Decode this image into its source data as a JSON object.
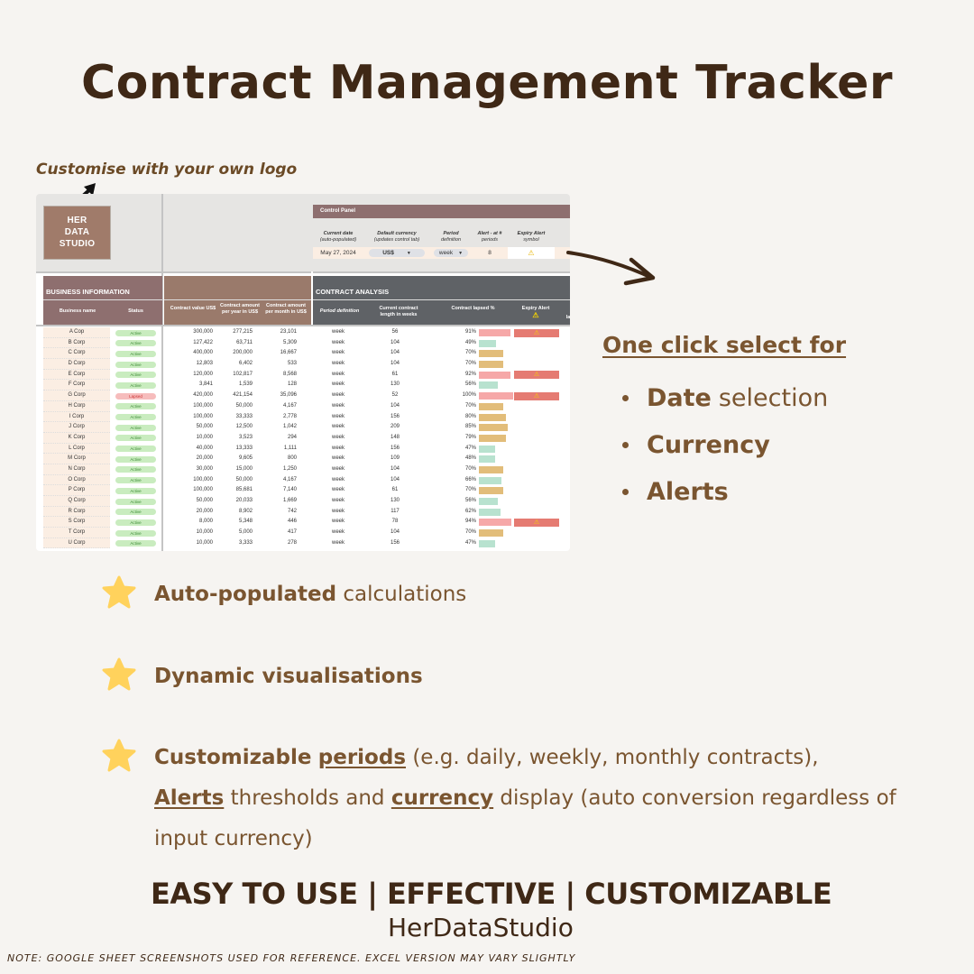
{
  "title": "Contract Management Tracker",
  "logo_note": "Customise with your own logo",
  "sheet": {
    "logo_text": [
      "HER",
      "DATA",
      "STUDIO"
    ],
    "control_panel": {
      "header": "Control Panel",
      "labels": [
        {
          "main": "Current date",
          "sub": "(auto-populated)"
        },
        {
          "main": "Default currency",
          "sub": "(updates control tab)"
        },
        {
          "main": "Period",
          "sub": "definition"
        },
        {
          "main": "Alert - at #",
          "sub": "periods"
        },
        {
          "main": "Expiry Alert",
          "sub": "symbol"
        }
      ],
      "current_date": "May 27, 2024",
      "currency": "US$",
      "period": "week",
      "alert_periods": "8",
      "alert_symbol": "⚠"
    },
    "sections": {
      "business": "BUSINESS INFORMATION",
      "analysis": "CONTRACT ANALYSIS"
    },
    "columns": {
      "business_name": "Business name",
      "status": "Status",
      "contract_value": "Contract value US$",
      "per_year": "Contract amount per year in US$",
      "per_month": "Contract amount per month in US$",
      "period_def": "Period definition",
      "length": "Current contract length in weeks",
      "lapsed": "Contract lapsed %",
      "expiry_alert": "Expiry Alert",
      "cut_off": "la"
    },
    "rows": [
      {
        "name": "A Cop",
        "status": "Active",
        "value": "300,000",
        "year": "277,215",
        "month": "23,101",
        "period": "week",
        "length": "56",
        "lapsed_pct": 91,
        "alert": true
      },
      {
        "name": "B Corp",
        "status": "Active",
        "value": "127,422",
        "year": "63,711",
        "month": "5,309",
        "period": "week",
        "length": "104",
        "lapsed_pct": 49,
        "alert": false
      },
      {
        "name": "C Corp",
        "status": "Active",
        "value": "400,000",
        "year": "200,000",
        "month": "16,667",
        "period": "week",
        "length": "104",
        "lapsed_pct": 70,
        "alert": false
      },
      {
        "name": "D Corp",
        "status": "Active",
        "value": "12,803",
        "year": "6,402",
        "month": "533",
        "period": "week",
        "length": "104",
        "lapsed_pct": 70,
        "alert": false
      },
      {
        "name": "E Corp",
        "status": "Active",
        "value": "120,000",
        "year": "102,817",
        "month": "8,568",
        "period": "week",
        "length": "61",
        "lapsed_pct": 92,
        "alert": true
      },
      {
        "name": "F Corp",
        "status": "Active",
        "value": "3,841",
        "year": "1,539",
        "month": "128",
        "period": "week",
        "length": "130",
        "lapsed_pct": 56,
        "alert": false
      },
      {
        "name": "G Corp",
        "status": "Lapsed",
        "value": "420,000",
        "year": "421,154",
        "month": "35,096",
        "period": "week",
        "length": "52",
        "lapsed_pct": 100,
        "alert": true
      },
      {
        "name": "H Corp",
        "status": "Active",
        "value": "100,000",
        "year": "50,000",
        "month": "4,167",
        "period": "week",
        "length": "104",
        "lapsed_pct": 70,
        "alert": false
      },
      {
        "name": "I Corp",
        "status": "Active",
        "value": "100,000",
        "year": "33,333",
        "month": "2,778",
        "period": "week",
        "length": "156",
        "lapsed_pct": 80,
        "alert": false
      },
      {
        "name": "J Corp",
        "status": "Active",
        "value": "50,000",
        "year": "12,500",
        "month": "1,042",
        "period": "week",
        "length": "209",
        "lapsed_pct": 85,
        "alert": false
      },
      {
        "name": "K Corp",
        "status": "Active",
        "value": "10,000",
        "year": "3,523",
        "month": "294",
        "period": "week",
        "length": "148",
        "lapsed_pct": 79,
        "alert": false
      },
      {
        "name": "L Corp",
        "status": "Active",
        "value": "40,000",
        "year": "13,333",
        "month": "1,111",
        "period": "week",
        "length": "156",
        "lapsed_pct": 47,
        "alert": false
      },
      {
        "name": "M Corp",
        "status": "Active",
        "value": "20,000",
        "year": "9,605",
        "month": "800",
        "period": "week",
        "length": "109",
        "lapsed_pct": 48,
        "alert": false
      },
      {
        "name": "N Corp",
        "status": "Active",
        "value": "30,000",
        "year": "15,000",
        "month": "1,250",
        "period": "week",
        "length": "104",
        "lapsed_pct": 70,
        "alert": false
      },
      {
        "name": "O Corp",
        "status": "Active",
        "value": "100,000",
        "year": "50,000",
        "month": "4,167",
        "period": "week",
        "length": "104",
        "lapsed_pct": 66,
        "alert": false
      },
      {
        "name": "P Corp",
        "status": "Active",
        "value": "100,000",
        "year": "85,681",
        "month": "7,140",
        "period": "week",
        "length": "61",
        "lapsed_pct": 70,
        "alert": false
      },
      {
        "name": "Q Corp",
        "status": "Active",
        "value": "50,000",
        "year": "20,033",
        "month": "1,669",
        "period": "week",
        "length": "130",
        "lapsed_pct": 56,
        "alert": false
      },
      {
        "name": "R Corp",
        "status": "Active",
        "value": "20,000",
        "year": "8,902",
        "month": "742",
        "period": "week",
        "length": "117",
        "lapsed_pct": 62,
        "alert": false
      },
      {
        "name": "S Corp",
        "status": "Active",
        "value": "8,000",
        "year": "5,348",
        "month": "446",
        "period": "week",
        "length": "78",
        "lapsed_pct": 94,
        "alert": true
      },
      {
        "name": "T Corp",
        "status": "Active",
        "value": "10,000",
        "year": "5,000",
        "month": "417",
        "period": "week",
        "length": "104",
        "lapsed_pct": 70,
        "alert": false
      },
      {
        "name": "U Corp",
        "status": "Active",
        "value": "10,000",
        "year": "3,333",
        "month": "278",
        "period": "week",
        "length": "156",
        "lapsed_pct": 47,
        "alert": false
      }
    ],
    "bar_colors": {
      "low": "#b8e2cf",
      "mid": "#e2bd7a",
      "high": "#f6a8a8",
      "alert": "#e57b72"
    }
  },
  "oneclick": {
    "heading": "One click select for",
    "items": [
      {
        "bold": "Date",
        "rest": "selection"
      },
      {
        "bold": "Currency",
        "rest": ""
      },
      {
        "bold": "Alerts",
        "rest": ""
      }
    ]
  },
  "features": [
    {
      "bold": "Auto-populated",
      "rest": " calculations"
    },
    {
      "bold": "Dynamic visualisations",
      "rest": ""
    },
    {
      "parts": {
        "b1": "Customizable",
        "u1": "periods",
        "t1": " (e.g. daily, weekly, monthly contracts),",
        "u2": "Alerts",
        "t2": " thresholds and ",
        "u3": "currency",
        "t3": " display (auto conversion regardless of input currency)"
      }
    }
  ],
  "tagline": "EASY TO USE | EFFECTIVE | CUSTOMIZABLE",
  "brand": "HerDataStudio",
  "note": "NOTE: GOOGLE SHEET SCREENSHOTS USED FOR REFERENCE. EXCEL VERSION MAY VARY SLIGHTLY",
  "colors": {
    "brand_dark": "#3f2816",
    "brand_text": "#7a5530",
    "star": "#ffd25c",
    "background": "#f6f4f1"
  }
}
